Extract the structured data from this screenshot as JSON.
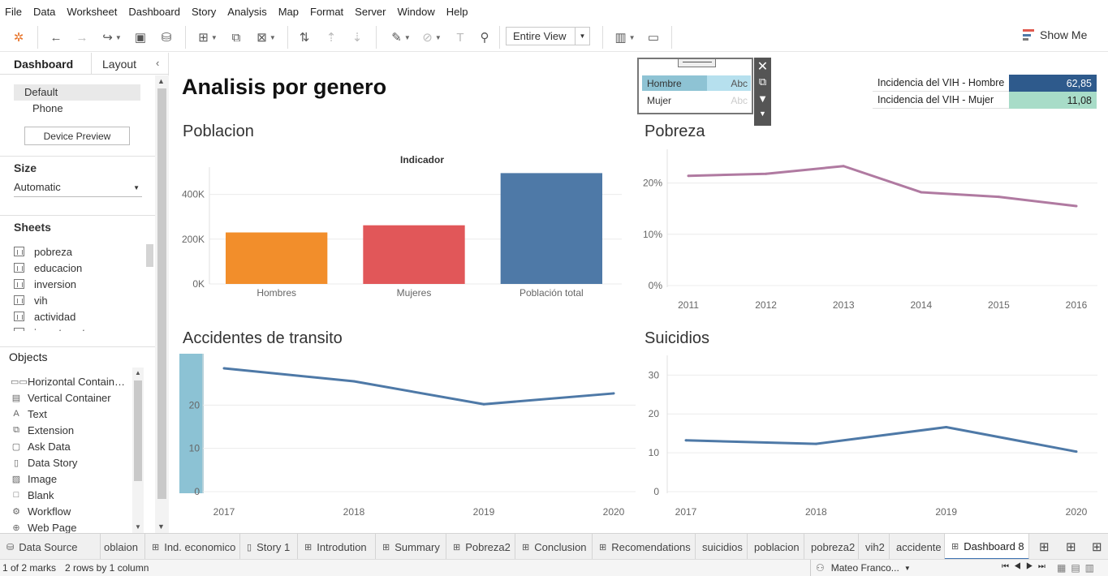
{
  "menu": [
    "File",
    "Data",
    "Worksheet",
    "Dashboard",
    "Story",
    "Analysis",
    "Map",
    "Format",
    "Server",
    "Window",
    "Help"
  ],
  "toolbar": {
    "fit_label": "Entire View",
    "show_me_label": "Show Me"
  },
  "left_panel": {
    "tabs": [
      "Dashboard",
      "Layout"
    ],
    "device_options": [
      "Default",
      "Phone"
    ],
    "device_preview_label": "Device Preview",
    "size_title": "Size",
    "size_value": "Automatic",
    "sheets_title": "Sheets",
    "sheets": [
      "pobreza",
      "educacion",
      "inversion",
      "vih",
      "actividad",
      "investment"
    ],
    "objects_title": "Objects",
    "objects": [
      "Horizontal Contain…",
      "Vertical Container",
      "Text",
      "Extension",
      "Ask Data",
      "Data Story",
      "Image",
      "Blank",
      "Workflow",
      "Web Page"
    ]
  },
  "dashboard": {
    "title": "Analisis por genero",
    "poblacion": {
      "title": "Poblacion",
      "chart_data": {
        "type": "bar",
        "header": "Indicador",
        "categories": [
          "Hombres",
          "Mujeres",
          "Población total"
        ],
        "values": [
          230000,
          262000,
          495000
        ],
        "colors": [
          "#f28e2b",
          "#e15759",
          "#4e79a7"
        ],
        "ylim": [
          0,
          500000
        ],
        "yticks": [
          "0K",
          "200K",
          "400K"
        ],
        "ytick_values": [
          0,
          200000,
          400000
        ]
      }
    },
    "pobreza": {
      "title": "Pobreza",
      "chart_data": {
        "type": "line",
        "x": [
          "2011",
          "2012",
          "2013",
          "2014",
          "2015",
          "2016"
        ],
        "values": [
          21.4,
          21.8,
          23.3,
          18.2,
          17.3,
          15.5
        ],
        "color": "#b07aa1",
        "ylim": [
          0,
          25
        ],
        "yticks": [
          "0%",
          "10%",
          "20%"
        ],
        "ytick_values": [
          0,
          10,
          20
        ]
      }
    },
    "accidentes": {
      "title": "Accidentes de transito",
      "chart_data": {
        "type": "line",
        "x": [
          "2017",
          "2018",
          "2019",
          "2020"
        ],
        "values": [
          28.5,
          25.5,
          20.2,
          22.7
        ],
        "color": "#4e79a7",
        "ylim": [
          0,
          30
        ],
        "yticks": [
          "0",
          "10",
          "20"
        ],
        "ytick_values": [
          0,
          10,
          20
        ]
      }
    },
    "suicidios": {
      "title": "Suicidios",
      "chart_data": {
        "type": "line",
        "x": [
          "2017",
          "2018",
          "2019",
          "2020"
        ],
        "values": [
          13.2,
          12.3,
          16.6,
          10.3
        ],
        "color": "#4e79a7",
        "ylim": [
          0,
          33
        ],
        "yticks": [
          "0",
          "10",
          "20",
          "30"
        ],
        "ytick_values": [
          0,
          10,
          20,
          30
        ]
      }
    },
    "filter": {
      "items": [
        {
          "label": "Hombre",
          "abc": "Abc"
        },
        {
          "label": "Mujer",
          "abc": "Abc"
        }
      ]
    },
    "vih": [
      {
        "label": "Incidencia del VIH - Hombre",
        "value": "62,85",
        "color": "#2e5a8c"
      },
      {
        "label": "Incidencia del VIH - Mujer",
        "value": "11,08",
        "color": "#a8dcc8"
      }
    ]
  },
  "tabs": [
    "Data Source",
    "oblaion",
    "Ind. economico",
    "Story 1",
    "Introdution",
    "Summary",
    "Pobreza2",
    "Conclusion",
    "Recomendations",
    "suicidios",
    "poblacion",
    "pobreza2",
    "vih2",
    "accidente",
    "Dashboard 8"
  ],
  "status": {
    "marks": "1 of 2 marks",
    "rows": "2 rows by 1 column",
    "user": "Mateo Franco..."
  }
}
